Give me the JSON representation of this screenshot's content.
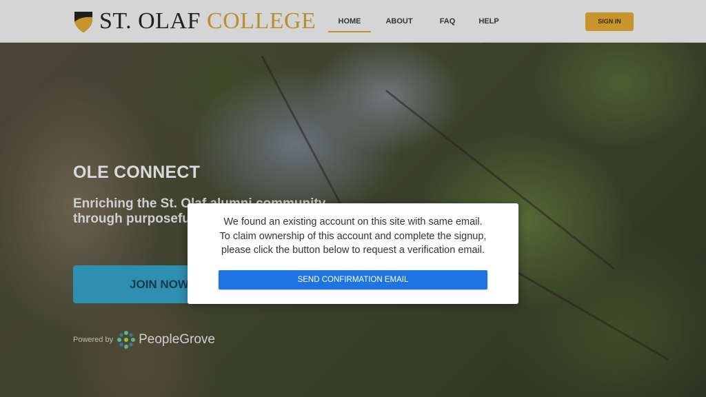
{
  "brand": {
    "name_part1": "ST. OLAF",
    "name_part2": "COLLEGE",
    "accent_color": "#b8902f"
  },
  "nav": {
    "items": [
      {
        "label": "HOME",
        "active": true
      },
      {
        "label": "ABOUT",
        "active": false
      },
      {
        "label": "FAQ",
        "active": false
      },
      {
        "label": "HELP",
        "active": false
      }
    ],
    "sign_in_label": "SIGN IN"
  },
  "hero": {
    "title": "OLE CONNECT",
    "subtitle": "Enriching the St. Olaf alumni community through purposeful connections.",
    "join_label": "JOIN NOW",
    "powered_by_label": "Powered by",
    "powered_by_brand": "PeopleGrove"
  },
  "modal": {
    "message_lines": [
      "We found an existing account on this site with same email.",
      "To claim ownership of this account and complete the signup,",
      "please click the button below to request a verification email."
    ],
    "button_label": "SEND CONFIRMATION EMAIL",
    "button_color": "#1f74e3"
  }
}
